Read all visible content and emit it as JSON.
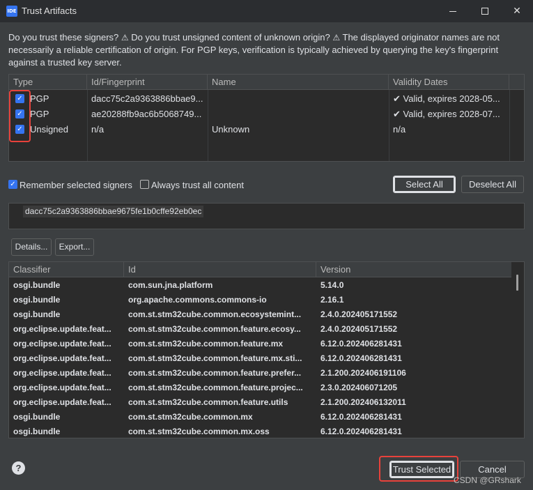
{
  "window": {
    "title": "Trust Artifacts",
    "app_icon_text": "IDE",
    "close_glyph": "✕"
  },
  "warning": {
    "part1": "Do you trust these signers?",
    "part2": "Do you trust unsigned content of unknown origin?",
    "part3": "The displayed originator names are not necessarily a reliable certification of origin.  For PGP keys, verification is typically achieved by querying the key's fingerprint against a trusted key server.",
    "icon": "⚠"
  },
  "signers": {
    "headers": [
      "Type",
      "Id/Fingerprint",
      "Name",
      "Validity Dates"
    ],
    "rows": [
      {
        "checked": true,
        "type": "PGP",
        "id": "dacc75c2a9363886bbae9...",
        "name": "",
        "validity": "Valid, expires 2028-05..."
      },
      {
        "checked": true,
        "type": "PGP",
        "id": "ae20288fb9ac6b5068749...",
        "name": "",
        "validity": "Valid, expires 2028-07..."
      },
      {
        "checked": true,
        "type": "Unsigned",
        "id": "n/a",
        "name": "Unknown",
        "validity": "n/a"
      }
    ],
    "valid_icon": "✔"
  },
  "options": {
    "remember_label": "Remember selected signers",
    "remember_checked": true,
    "always_trust_label": "Always trust all content",
    "always_trust_checked": false,
    "select_all": "Select All",
    "deselect_all": "Deselect All"
  },
  "fingerprint": "dacc75c2a9363886bbae9675fe1b0cffe92eb0ec",
  "details_button": "Details...",
  "export_button": "Export...",
  "artifacts": {
    "headers": [
      "Classifier",
      "Id",
      "Version"
    ],
    "rows": [
      {
        "classifier": "osgi.bundle",
        "id": "com.sun.jna.platform",
        "version": "5.14.0"
      },
      {
        "classifier": "osgi.bundle",
        "id": "org.apache.commons.commons-io",
        "version": "2.16.1"
      },
      {
        "classifier": "osgi.bundle",
        "id": "com.st.stm32cube.common.ecosystemint...",
        "version": "2.4.0.202405171552"
      },
      {
        "classifier": "org.eclipse.update.feat...",
        "id": "com.st.stm32cube.common.feature.ecosy...",
        "version": "2.4.0.202405171552"
      },
      {
        "classifier": "org.eclipse.update.feat...",
        "id": "com.st.stm32cube.common.feature.mx",
        "version": "6.12.0.202406281431"
      },
      {
        "classifier": "org.eclipse.update.feat...",
        "id": "com.st.stm32cube.common.feature.mx.sti...",
        "version": "6.12.0.202406281431"
      },
      {
        "classifier": "org.eclipse.update.feat...",
        "id": "com.st.stm32cube.common.feature.prefer...",
        "version": "2.1.200.202406191106"
      },
      {
        "classifier": "org.eclipse.update.feat...",
        "id": "com.st.stm32cube.common.feature.projec...",
        "version": "2.3.0.202406071205"
      },
      {
        "classifier": "org.eclipse.update.feat...",
        "id": "com.st.stm32cube.common.feature.utils",
        "version": "2.1.200.202406132011"
      },
      {
        "classifier": "osgi.bundle",
        "id": "com.st.stm32cube.common.mx",
        "version": "6.12.0.202406281431"
      },
      {
        "classifier": "osgi.bundle",
        "id": "com.st.stm32cube.common.mx.oss",
        "version": "6.12.0.202406281431"
      }
    ]
  },
  "footer": {
    "help": "?",
    "trust_selected": "Trust Selected",
    "cancel": "Cancel",
    "watermark": "CSDN @GRshark"
  },
  "colors": {
    "accent": "#3574f0",
    "highlight": "#e8423b"
  }
}
